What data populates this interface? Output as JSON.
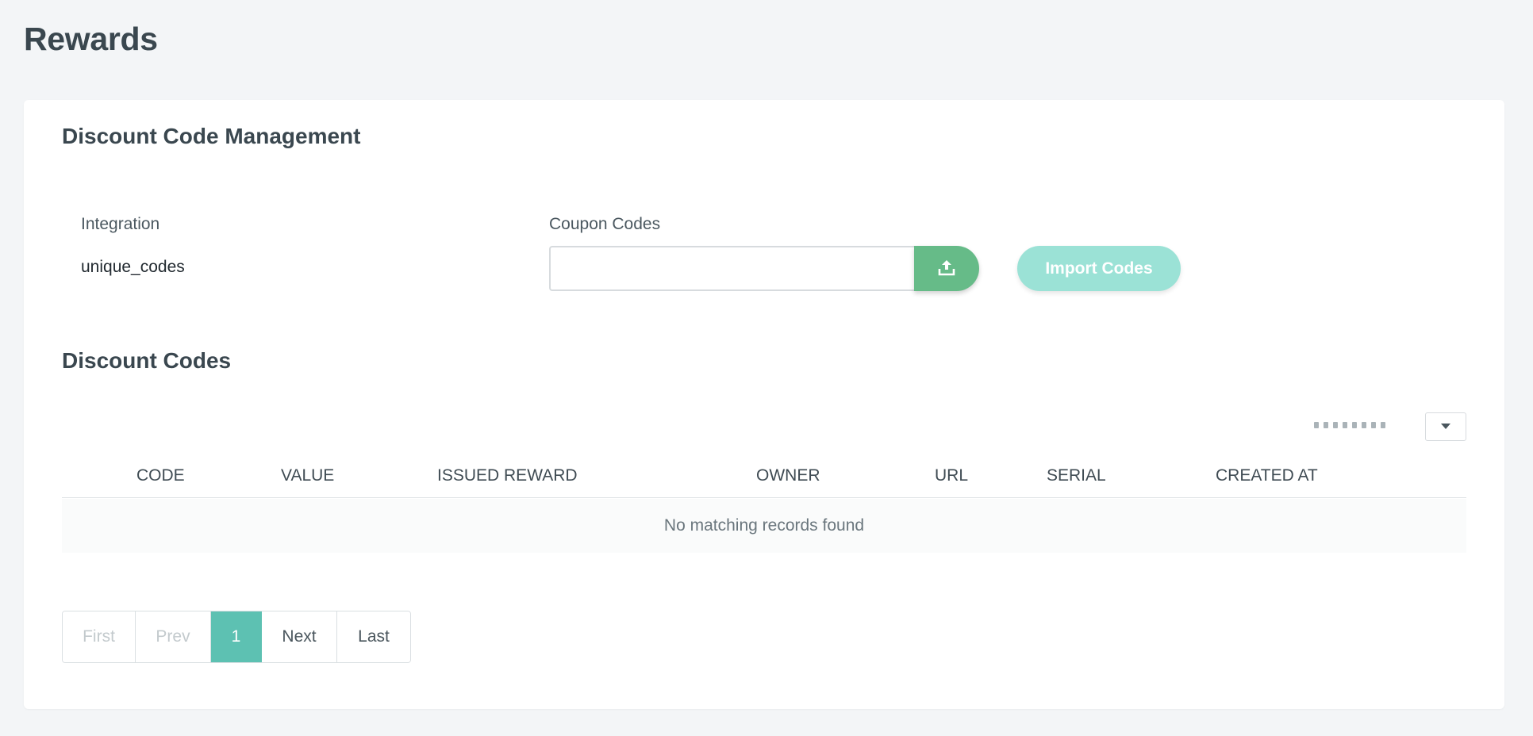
{
  "page": {
    "title": "Rewards"
  },
  "management": {
    "title": "Discount Code Management",
    "integration_label": "Integration",
    "integration_value": "unique_codes",
    "coupon_label": "Coupon Codes",
    "coupon_value": "",
    "upload_icon": "upload-icon",
    "import_label": "Import Codes"
  },
  "codes": {
    "title": "Discount Codes",
    "columns": [
      "CODE",
      "VALUE",
      "ISSUED REWARD",
      "OWNER",
      "URL",
      "SERIAL",
      "CREATED AT"
    ],
    "empty_message": "No matching records found"
  },
  "pagination": {
    "first": "First",
    "prev": "Prev",
    "current": "1",
    "next": "Next",
    "last": "Last"
  },
  "colors": {
    "accent": "#5dc1b2",
    "upload": "#66bb88",
    "import_disabled": "#9be2d6",
    "background": "#f3f5f7"
  }
}
